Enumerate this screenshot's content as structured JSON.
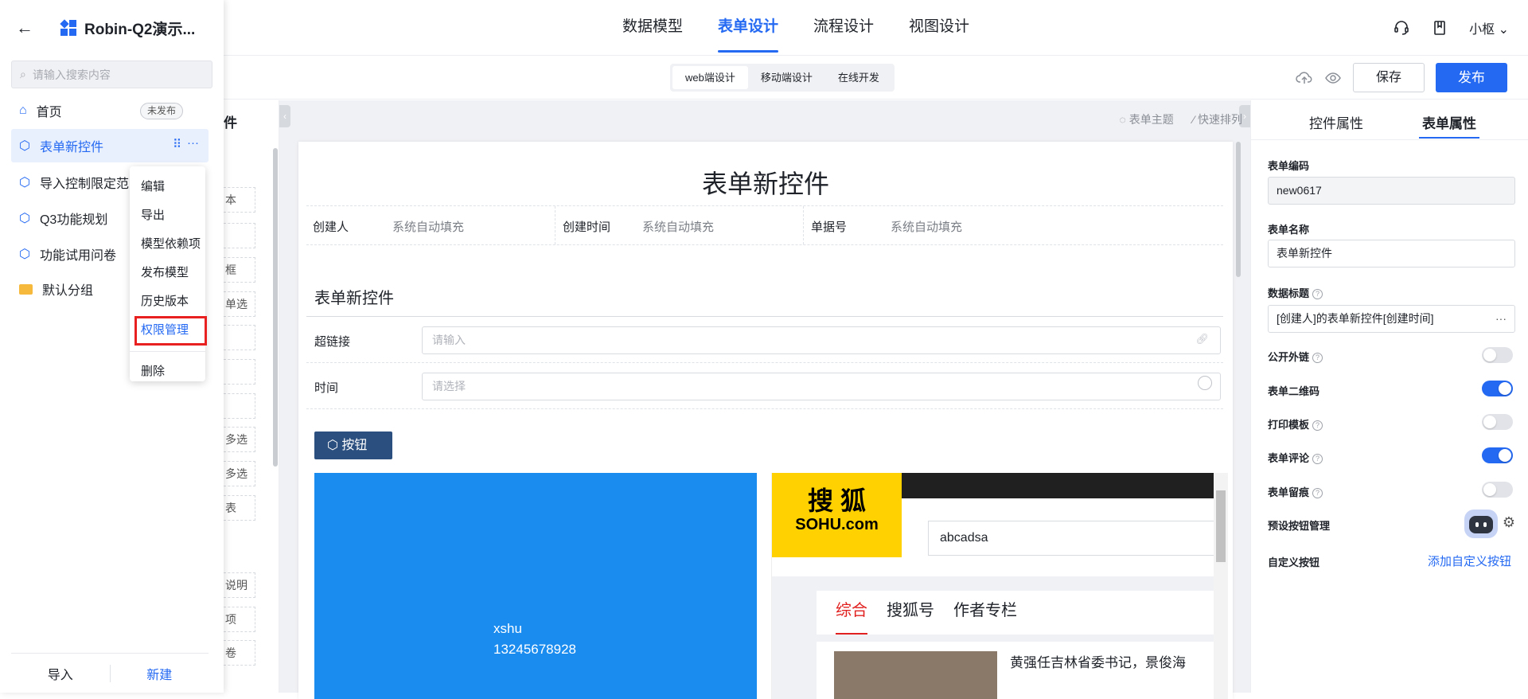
{
  "app": {
    "title": "Robin-Q2演示..."
  },
  "topnav": {
    "tabs": [
      "数据模型",
      "表单设计",
      "流程设计",
      "视图设计"
    ],
    "active": 1,
    "user": "小枢"
  },
  "secbar": {
    "modes": [
      "web端设计",
      "移动端设计",
      "在线开发"
    ],
    "save_label": "保存",
    "publish_label": "发布"
  },
  "sidebar": {
    "search_placeholder": "请输入搜索内容",
    "items": [
      {
        "label": "首页",
        "badge": "未发布"
      },
      {
        "label": "表单新控件"
      },
      {
        "label": "导入控制限定范"
      },
      {
        "label": "Q3功能规划"
      },
      {
        "label": "功能试用问卷"
      },
      {
        "label": "默认分组"
      }
    ],
    "import_label": "导入",
    "new_label": "新建"
  },
  "context_menu": [
    "编辑",
    "导出",
    "模型依赖项",
    "发布模型",
    "历史版本",
    "权限管理",
    "删除"
  ],
  "left_stubs": [
    "件",
    "本",
    "框",
    "单选框",
    "多选",
    "多选",
    "表",
    "说明",
    "项",
    "卷"
  ],
  "canvas": {
    "tools": [
      "表单主题",
      "快速排列"
    ],
    "form_title": "表单新控件",
    "sys_fields": [
      {
        "label": "创建人",
        "value": "系统自动填充"
      },
      {
        "label": "创建时间",
        "value": "系统自动填充"
      },
      {
        "label": "单据号",
        "value": "系统自动填充"
      }
    ],
    "section_title": "表单新控件",
    "hyperlink": {
      "label": "超链接",
      "placeholder": "请输入"
    },
    "time": {
      "label": "时间",
      "placeholder": "请选择"
    },
    "button_label": "按钮",
    "blue_box": {
      "line1": "xshu",
      "line2": "13245678928"
    },
    "sohu": {
      "logo_text": "搜 狐",
      "logo_sub": "SOHU.com",
      "search_value": "abcadsa",
      "tabs": [
        "综合",
        "搜狐号",
        "作者专栏"
      ],
      "headline": "黄强任吉林省委书记，景俊海"
    }
  },
  "props": {
    "tabs": [
      "控件属性",
      "表单属性"
    ],
    "form_code_label": "表单编码",
    "form_code": "new0617",
    "form_name_label": "表单名称",
    "form_name": "表单新控件",
    "data_title_label": "数据标题",
    "data_title": "[创建人]的表单新控件[创建时间]",
    "toggles": [
      {
        "label": "公开外链",
        "on": false,
        "help": true
      },
      {
        "label": "表单二维码",
        "on": true,
        "help": false
      },
      {
        "label": "打印模板",
        "on": false,
        "help": true
      },
      {
        "label": "表单评论",
        "on": true,
        "help": true
      },
      {
        "label": "表单留痕",
        "on": false,
        "help": true
      }
    ],
    "preset_label": "预设按钮管理",
    "custom_label": "自定义按钮",
    "add_custom": "添加自定义按钮"
  },
  "colors": {
    "accent": "#2469f2",
    "highlight_box": "#e82020",
    "blue_box": "#1a8cf0",
    "sohu_yellow": "#ffd100"
  }
}
